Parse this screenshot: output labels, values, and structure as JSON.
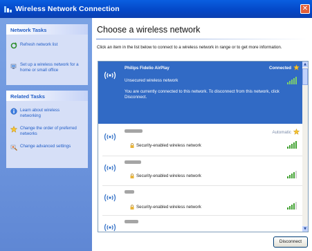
{
  "window": {
    "title": "Wireless Network Connection"
  },
  "sidebar": {
    "network_tasks": {
      "header": "Network Tasks",
      "items": [
        {
          "label": "Refresh network list",
          "icon": "refresh-icon"
        },
        {
          "label": "Set up a wireless network for a home or small office",
          "icon": "setup-network-icon"
        }
      ]
    },
    "related_tasks": {
      "header": "Related Tasks",
      "items": [
        {
          "label": "Learn about wireless networking",
          "icon": "info-icon"
        },
        {
          "label": "Change the order of preferred networks",
          "icon": "star-icon"
        },
        {
          "label": "Change advanced settings",
          "icon": "settings-icon"
        }
      ]
    }
  },
  "main": {
    "title": "Choose a wireless network",
    "instructions": "Click an item in the list below to connect to a wireless network in range or to get more information.",
    "networks": [
      {
        "name": "Philips Fidelio AirPlay",
        "status": "Connected",
        "security": "Unsecured wireless network",
        "message": "You are currently connected to this network. To disconnect from this network, click Disconnect.",
        "selected": true,
        "signal": 5
      },
      {
        "name": "",
        "status": "Automatic",
        "security": "Security-enabled wireless network",
        "selected": false,
        "signal": 5
      },
      {
        "name": "",
        "status": "",
        "security": "Security-enabled wireless network",
        "selected": false,
        "signal": 4
      },
      {
        "name": "",
        "status": "",
        "security": "Security-enabled wireless network",
        "selected": false,
        "signal": 4
      },
      {
        "name": "",
        "status": "",
        "security": "",
        "selected": false,
        "signal": 0
      }
    ],
    "button_label": "Disconnect"
  },
  "colors": {
    "titlebar": "#0448c8",
    "sidebar": "#6b93dc",
    "selection": "#316ac5",
    "signal_green": "#3fa02f"
  }
}
